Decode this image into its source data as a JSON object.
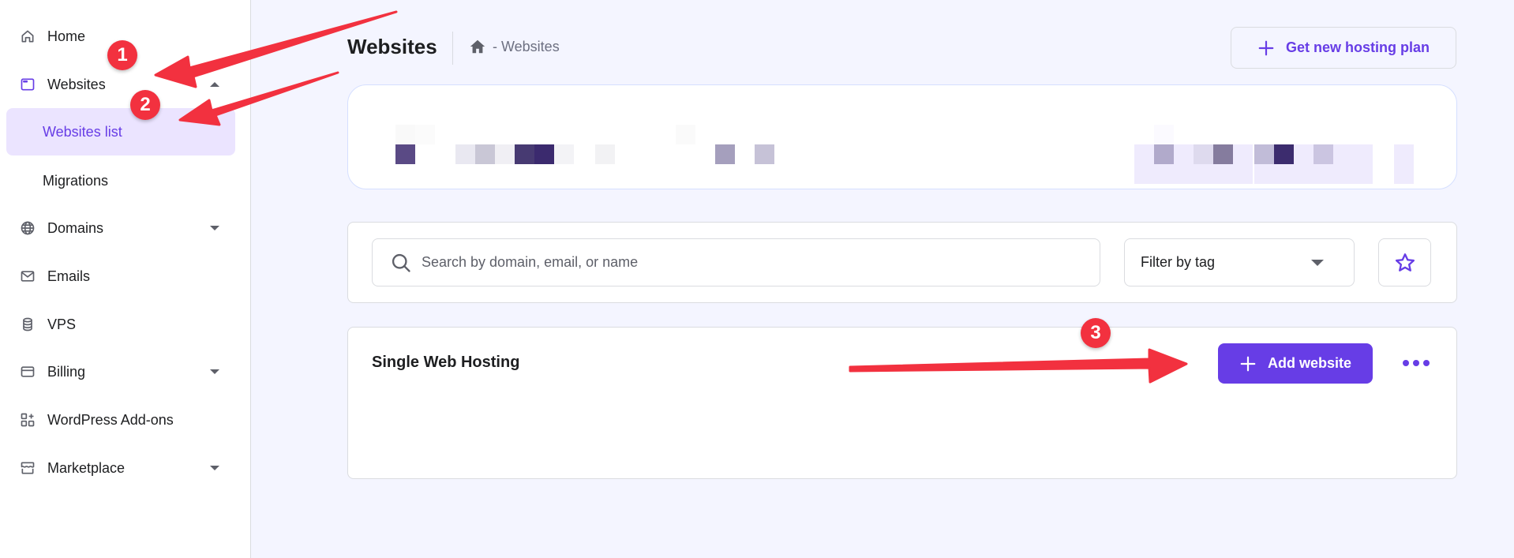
{
  "sidebar": {
    "items": [
      {
        "label": "Home",
        "icon": "home-icon",
        "caret": null
      },
      {
        "label": "Websites",
        "icon": "browser-window-icon",
        "caret": "up"
      },
      {
        "label": "Domains",
        "icon": "globe-icon",
        "caret": "down"
      },
      {
        "label": "Emails",
        "icon": "mail-icon",
        "caret": null
      },
      {
        "label": "VPS",
        "icon": "database-icon",
        "caret": null
      },
      {
        "label": "Billing",
        "icon": "credit-card-icon",
        "caret": "down"
      },
      {
        "label": "WordPress Add-ons",
        "icon": "add-ons-grid-icon",
        "caret": null
      },
      {
        "label": "Marketplace",
        "icon": "store-icon",
        "caret": "down"
      }
    ],
    "subitems": [
      {
        "label": "Websites list",
        "active": true
      },
      {
        "label": "Migrations",
        "active": false
      }
    ]
  },
  "header": {
    "title": "Websites",
    "breadcrumb": "- Websites",
    "new_plan_button": "Get new hosting plan"
  },
  "filters": {
    "search_placeholder": "Search by domain, email, or name",
    "search_value": "",
    "tag_filter_selected": "Filter by tag"
  },
  "hosting_section": {
    "title": "Single Web Hosting",
    "add_button": "Add website"
  },
  "annotations": [
    {
      "number": "1",
      "target": "Websites"
    },
    {
      "number": "2",
      "target": "Websites list"
    },
    {
      "number": "3",
      "target": "Add website"
    }
  ],
  "colors": {
    "accent": "#673de6",
    "accent_light": "#ebe4ff",
    "annotation_red": "#f2313f",
    "page_bg": "#f4f5ff"
  }
}
